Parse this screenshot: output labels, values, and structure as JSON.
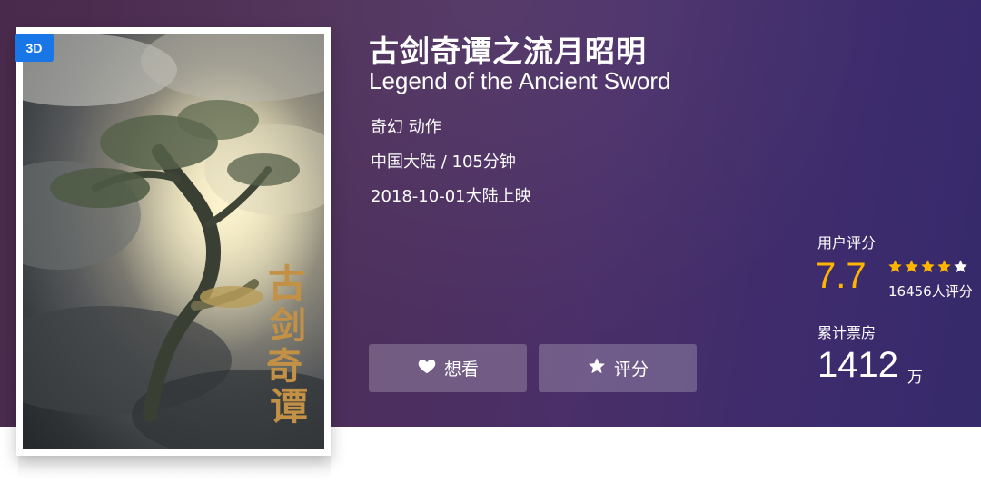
{
  "movie": {
    "badge": "3D",
    "title_cn": "古剑奇谭之流月昭明",
    "title_en": "Legend of the Ancient Sword",
    "genres": "奇幻 动作",
    "region_duration": "中国大陆 / 105分钟",
    "release": "2018-10-01大陆上映",
    "poster_calligraphy": [
      "古",
      "剑",
      "奇",
      "谭"
    ]
  },
  "actions": {
    "want_label": "想看",
    "want_icon": "heart-icon",
    "rate_label": "评分",
    "rate_icon": "star-icon"
  },
  "rating": {
    "label": "用户评分",
    "score": "7.7",
    "stars_filled": 4,
    "stars_total": 5,
    "count": "16456人评分",
    "accent_color": "#ffb400"
  },
  "box_office": {
    "label": "累计票房",
    "value": "1412",
    "unit": "万"
  },
  "colors": {
    "banner_left": "#4a2a4c",
    "banner_right": "#352a6a",
    "badge": "#1976e6"
  }
}
